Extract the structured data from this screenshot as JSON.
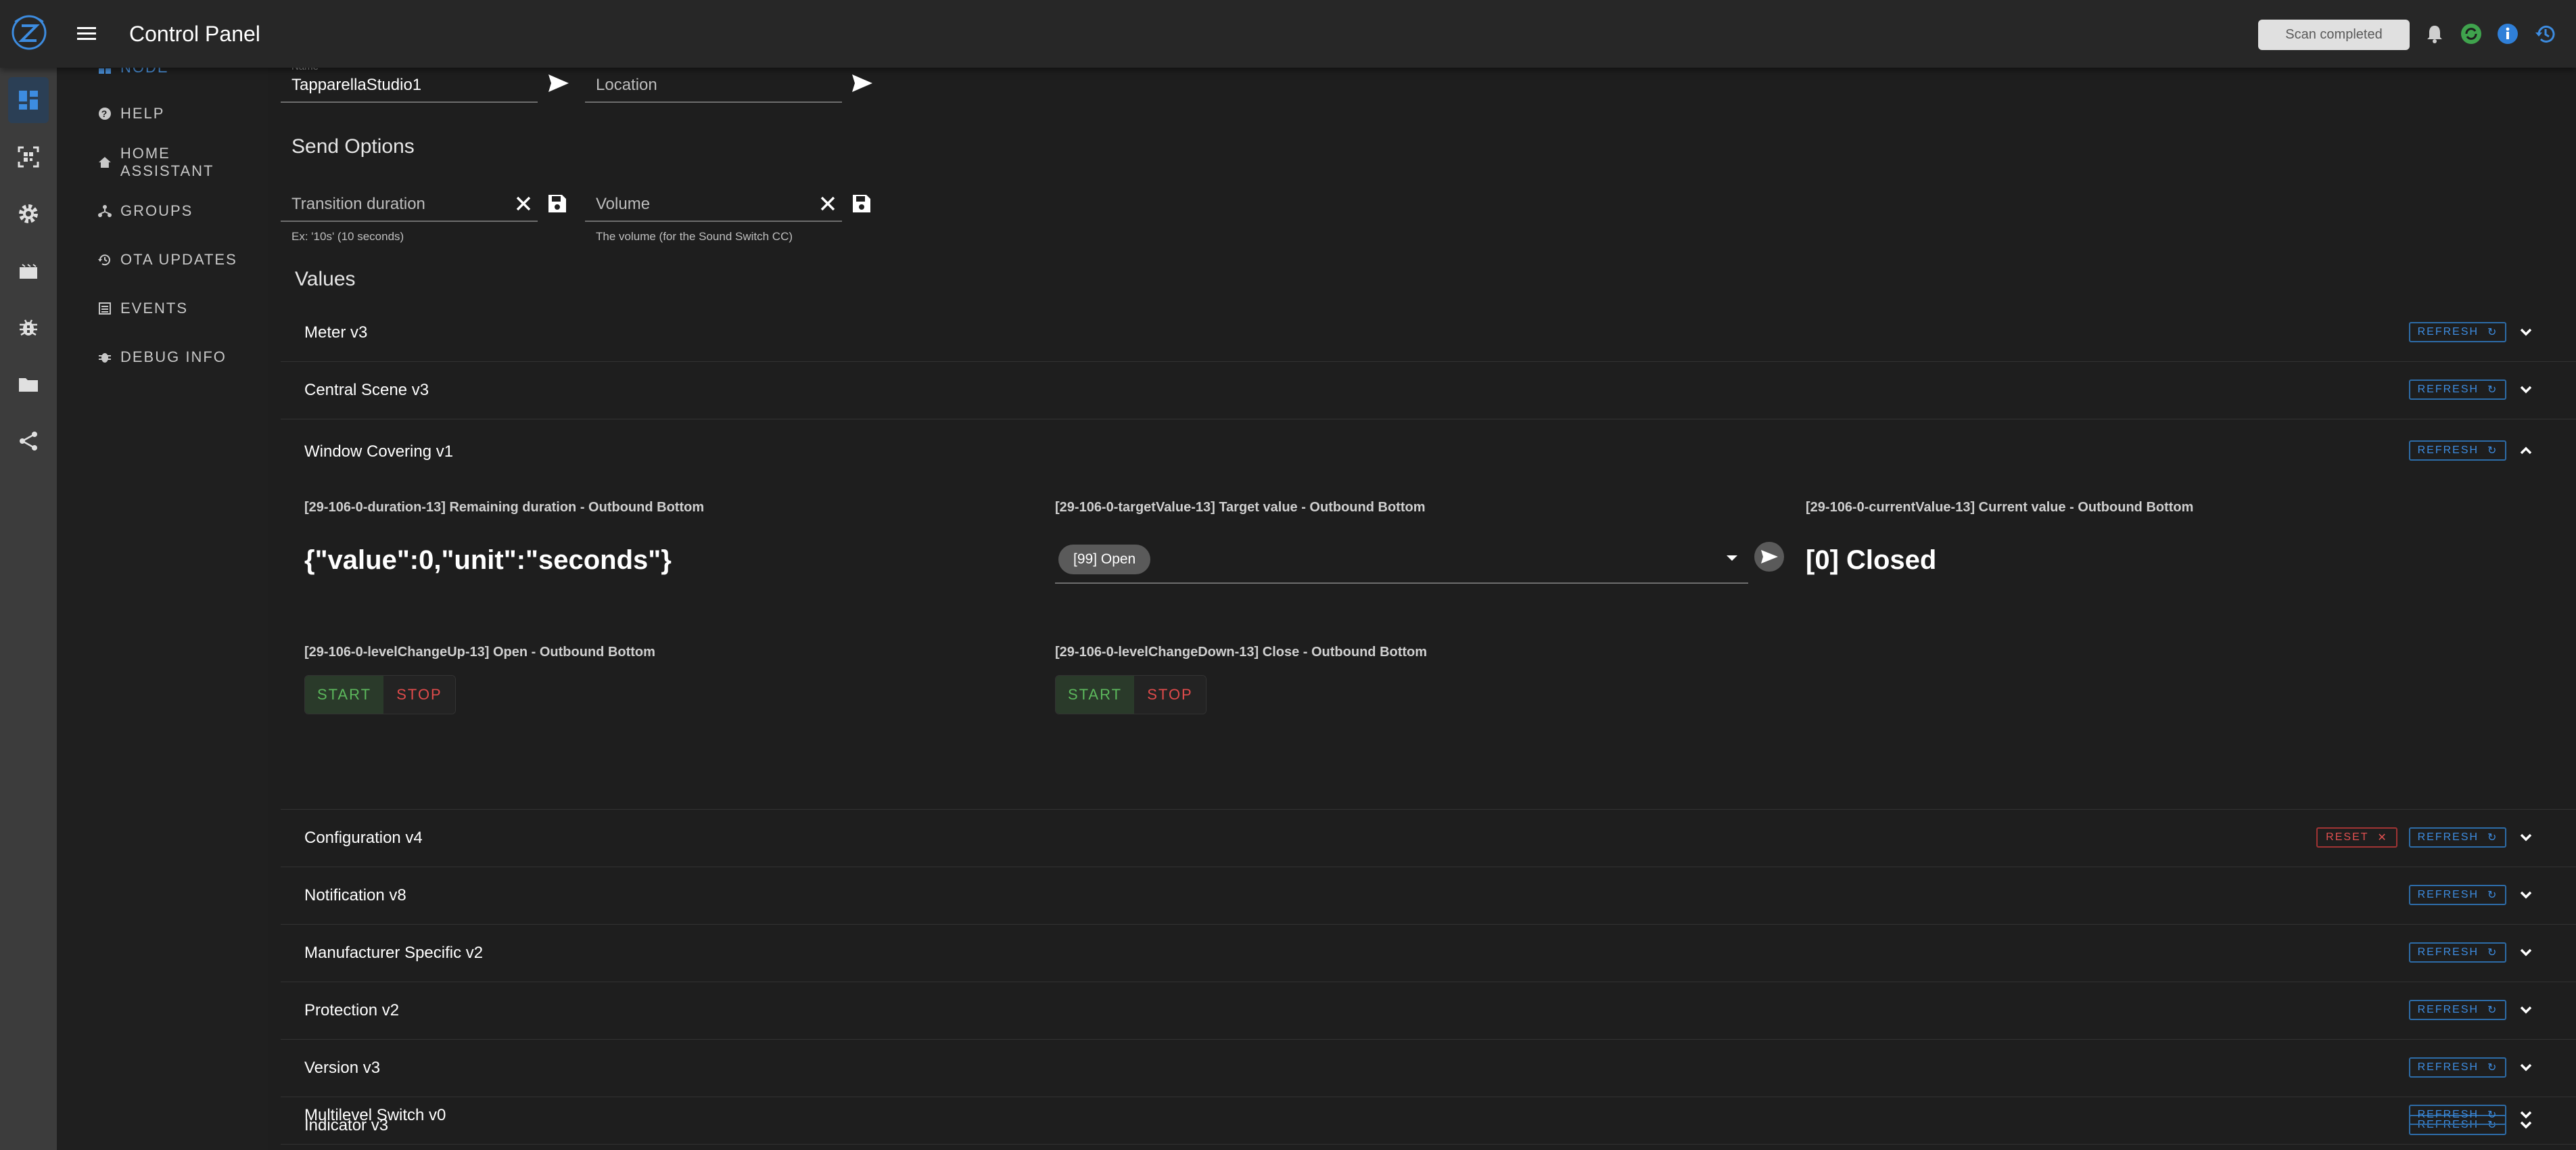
{
  "header": {
    "title": "Control Panel",
    "status_chip": "Scan completed",
    "icons": [
      "bell-icon",
      "sync-icon",
      "info-icon",
      "history-icon"
    ]
  },
  "rail": {
    "items": [
      "dashboard-icon",
      "qr-scan-icon",
      "settings-icon",
      "store-icon",
      "debug-icon",
      "folder-icon",
      "share-icon"
    ],
    "active_index": 0
  },
  "nav": {
    "node_label": "NODE",
    "items": [
      {
        "label": "HELP",
        "icon": "help-icon"
      },
      {
        "label": "HOME ASSISTANT",
        "icon": "home-icon"
      },
      {
        "label": "GROUPS",
        "icon": "groups-icon"
      },
      {
        "label": "OTA UPDATES",
        "icon": "ota-icon"
      },
      {
        "label": "EVENTS",
        "icon": "events-icon"
      },
      {
        "label": "DEBUG INFO",
        "icon": "bug-icon"
      }
    ]
  },
  "node_fields": {
    "name_label": "Name",
    "name_value": "TapparellaStudio1",
    "location_placeholder": "Location"
  },
  "send_options": {
    "title": "Send Options",
    "transition_placeholder": "Transition duration",
    "transition_hint": "Ex: '10s' (10 seconds)",
    "volume_placeholder": "Volume",
    "volume_hint": "The volume (for the Sound Switch CC)"
  },
  "values": {
    "title": "Values",
    "refresh_label": "REFRESH",
    "reset_label": "RESET",
    "panels": [
      "Meter v3",
      "Central Scene v3",
      "Window Covering v1",
      "Configuration v4",
      "Notification v8",
      "Manufacturer Specific v2",
      "Protection v2",
      "Version v3",
      "Indicator v3",
      "Multilevel Switch v0"
    ],
    "expanded": {
      "duration_label": "[29-106-0-duration-13] Remaining duration - Outbound Bottom",
      "duration_value": "{\"value\":0,\"unit\":\"seconds\"}",
      "target_label": "[29-106-0-targetValue-13] Target value - Outbound Bottom",
      "target_chip": "[99] Open",
      "current_label": "[29-106-0-currentValue-13] Current value - Outbound Bottom",
      "current_value": "[0] Closed",
      "up_label": "[29-106-0-levelChangeUp-13] Open - Outbound Bottom",
      "down_label": "[29-106-0-levelChangeDown-13] Close - Outbound Bottom",
      "start_label": "START",
      "stop_label": "STOP"
    }
  },
  "colors": {
    "accent": "#2d6ca8",
    "start_green": "#5cb85c",
    "stop_red": "#e04b4b"
  }
}
